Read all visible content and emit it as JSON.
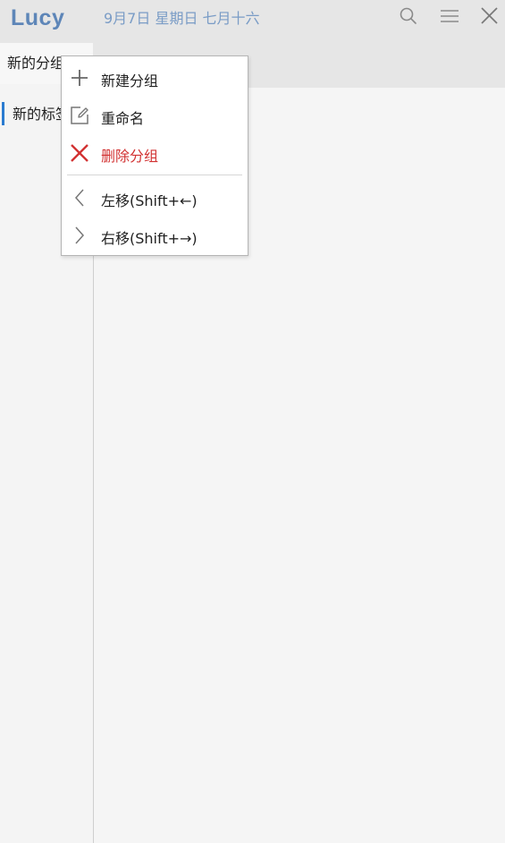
{
  "app": {
    "name": "Lucy",
    "date": "9月7日 星期日 七月十六"
  },
  "toolbar": {
    "icons": [
      "search-icon",
      "menu-icon",
      "close-icon"
    ]
  },
  "tabs": [
    {
      "label": "新的分组",
      "active": true
    }
  ],
  "sidebar": {
    "items": [
      {
        "label": "新的标签",
        "selected": true
      }
    ]
  },
  "context_menu": {
    "items": [
      {
        "icon": "plus-icon",
        "label": "新建分组"
      },
      {
        "icon": "edit-icon",
        "label": "重命名"
      },
      {
        "icon": "x-icon",
        "label": "删除分组",
        "color": "#d23232"
      },
      {
        "icon": "chevron-left-icon",
        "label": "左移(Shift+←)"
      },
      {
        "icon": "chevron-right-icon",
        "label": "右移(Shift+→)"
      }
    ]
  },
  "colors": {
    "brand": "#5e86b8",
    "date_text": "#7a9cc6",
    "accent": "#2a7bd0",
    "danger": "#d23232"
  }
}
